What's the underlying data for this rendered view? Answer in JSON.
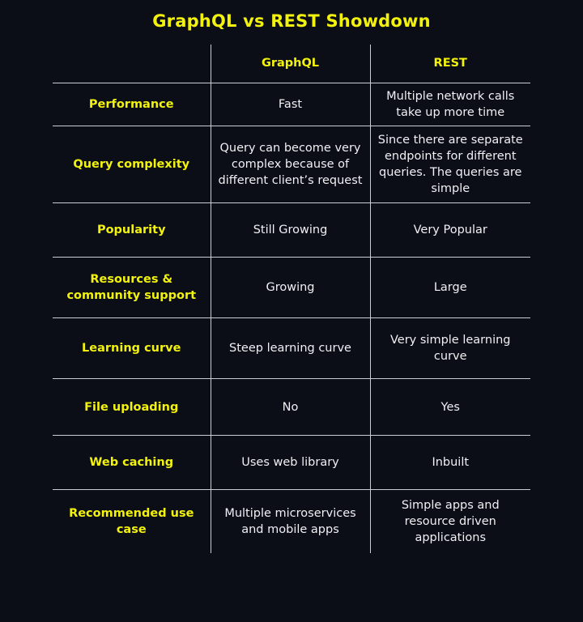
{
  "slide": {
    "title": "GraphQL vs REST Showdown",
    "background_color": "#0b0d17",
    "accent_color": "#f2f20d",
    "body_text_color": "#f0f1f4",
    "rule_color": "#c9cdd6"
  },
  "table": {
    "headers": {
      "feature": "",
      "graphql": "GraphQL",
      "rest": "REST"
    },
    "rows": [
      {
        "feature": "Performance",
        "graphql": "Fast",
        "rest": "Multiple network calls take up more time"
      },
      {
        "feature": "Query complexity",
        "graphql": "Query can become very complex because of different client’s request",
        "rest": "Since there are separate endpoints for different queries. The queries are simple"
      },
      {
        "feature": "Popularity",
        "graphql": "Still Growing",
        "rest": "Very Popular"
      },
      {
        "feature": "Resources & community support",
        "graphql": "Growing",
        "rest": "Large"
      },
      {
        "feature": "Learning curve",
        "graphql": "Steep learning curve",
        "rest": "Very simple learning curve"
      },
      {
        "feature": "File uploading",
        "graphql": "No",
        "rest": "Yes"
      },
      {
        "feature": "Web caching",
        "graphql": "Uses web library",
        "rest": "Inbuilt"
      },
      {
        "feature": "Recommended use case",
        "graphql": "Multiple microservices and mobile apps",
        "rest": "Simple apps and resource driven applications"
      }
    ]
  }
}
